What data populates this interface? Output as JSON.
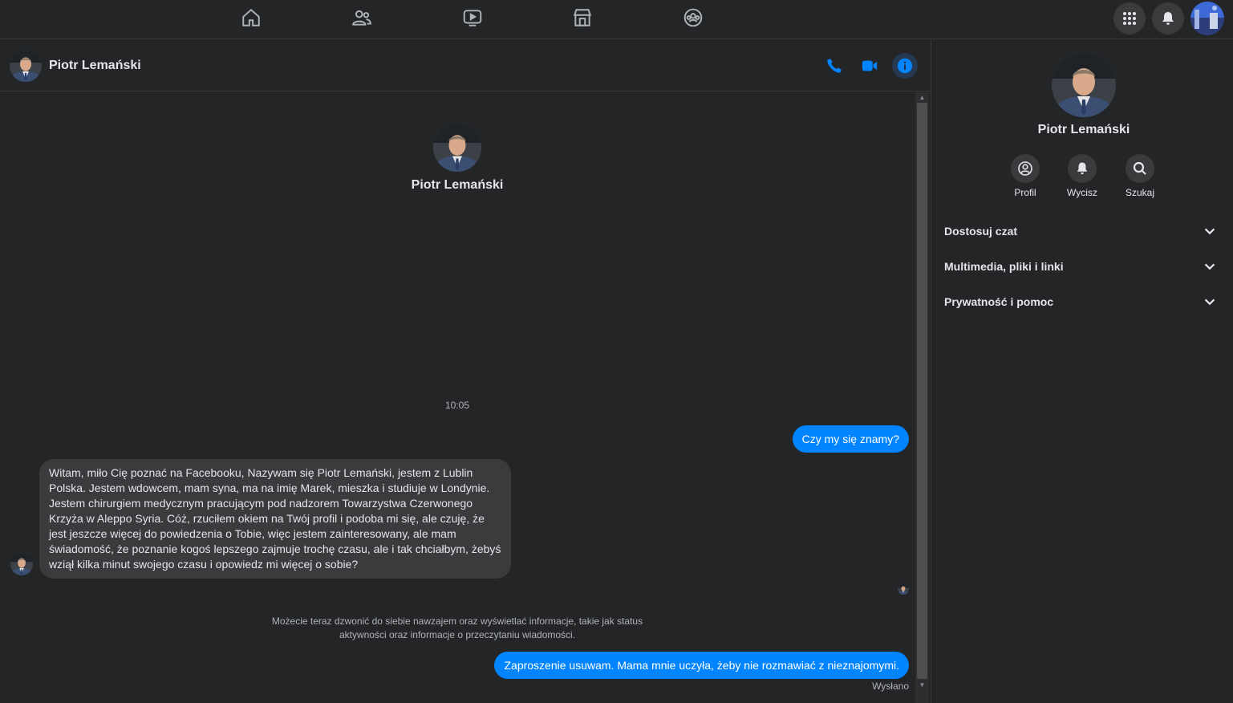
{
  "contact": {
    "name": "Piotr Lemański"
  },
  "conversation": {
    "timestamp": "10:05",
    "messages": [
      {
        "direction": "outgoing",
        "text": "Czy my się znamy?"
      },
      {
        "direction": "incoming",
        "text": "Witam, miło Cię poznać na Facebooku, Nazywam się Piotr Lemański, jestem z Lublin Polska. Jestem wdowcem, mam syna, ma na imię Marek, mieszka i studiuje w Londynie. Jestem chirurgiem medycznym pracującym pod nadzorem Towarzystwa Czerwonego Krzyża w Aleppo Syria. Cóż, rzuciłem okiem na Twój profil i podoba mi się, ale czuję, że jest jeszcze więcej do powiedzenia o Tobie, więc jestem zainteresowany, ale mam świadomość, że poznanie kogoś lepszego zajmuje trochę czasu, ale i tak chciałbym, żebyś wziął kilka minut swojego czasu i opowiedz mi więcej o sobie?"
      },
      {
        "direction": "outgoing",
        "text": "Zaproszenie usuwam. Mama mnie uczyła, żeby nie rozmawiać z nieznajomymi."
      }
    ],
    "notice": "Możecie teraz dzwonić do siebie nawzajem oraz wyświetlać informacje, takie jak status aktywności oraz informacje o przeczytaniu wiadomości.",
    "status": "Wysłano"
  },
  "right_panel": {
    "actions": [
      {
        "label": "Profil",
        "icon": "profile-icon"
      },
      {
        "label": "Wycisz",
        "icon": "bell-icon"
      },
      {
        "label": "Szukaj",
        "icon": "search-icon"
      }
    ],
    "sections": [
      {
        "label": "Dostosuj czat"
      },
      {
        "label": "Multimedia, pliki i linki"
      },
      {
        "label": "Prywatność i pomoc"
      }
    ]
  },
  "colors": {
    "accent": "#0084ff",
    "background": "#242526",
    "bubble_incoming": "#3a3b3c"
  },
  "icons": {
    "top_nav": [
      "home-icon",
      "friends-icon",
      "watch-icon",
      "marketplace-icon",
      "groups-icon"
    ],
    "top_right": [
      "menu-grid-icon",
      "notifications-bell-icon",
      "account-avatar"
    ],
    "header": [
      "phone-icon",
      "video-icon",
      "info-icon"
    ]
  }
}
